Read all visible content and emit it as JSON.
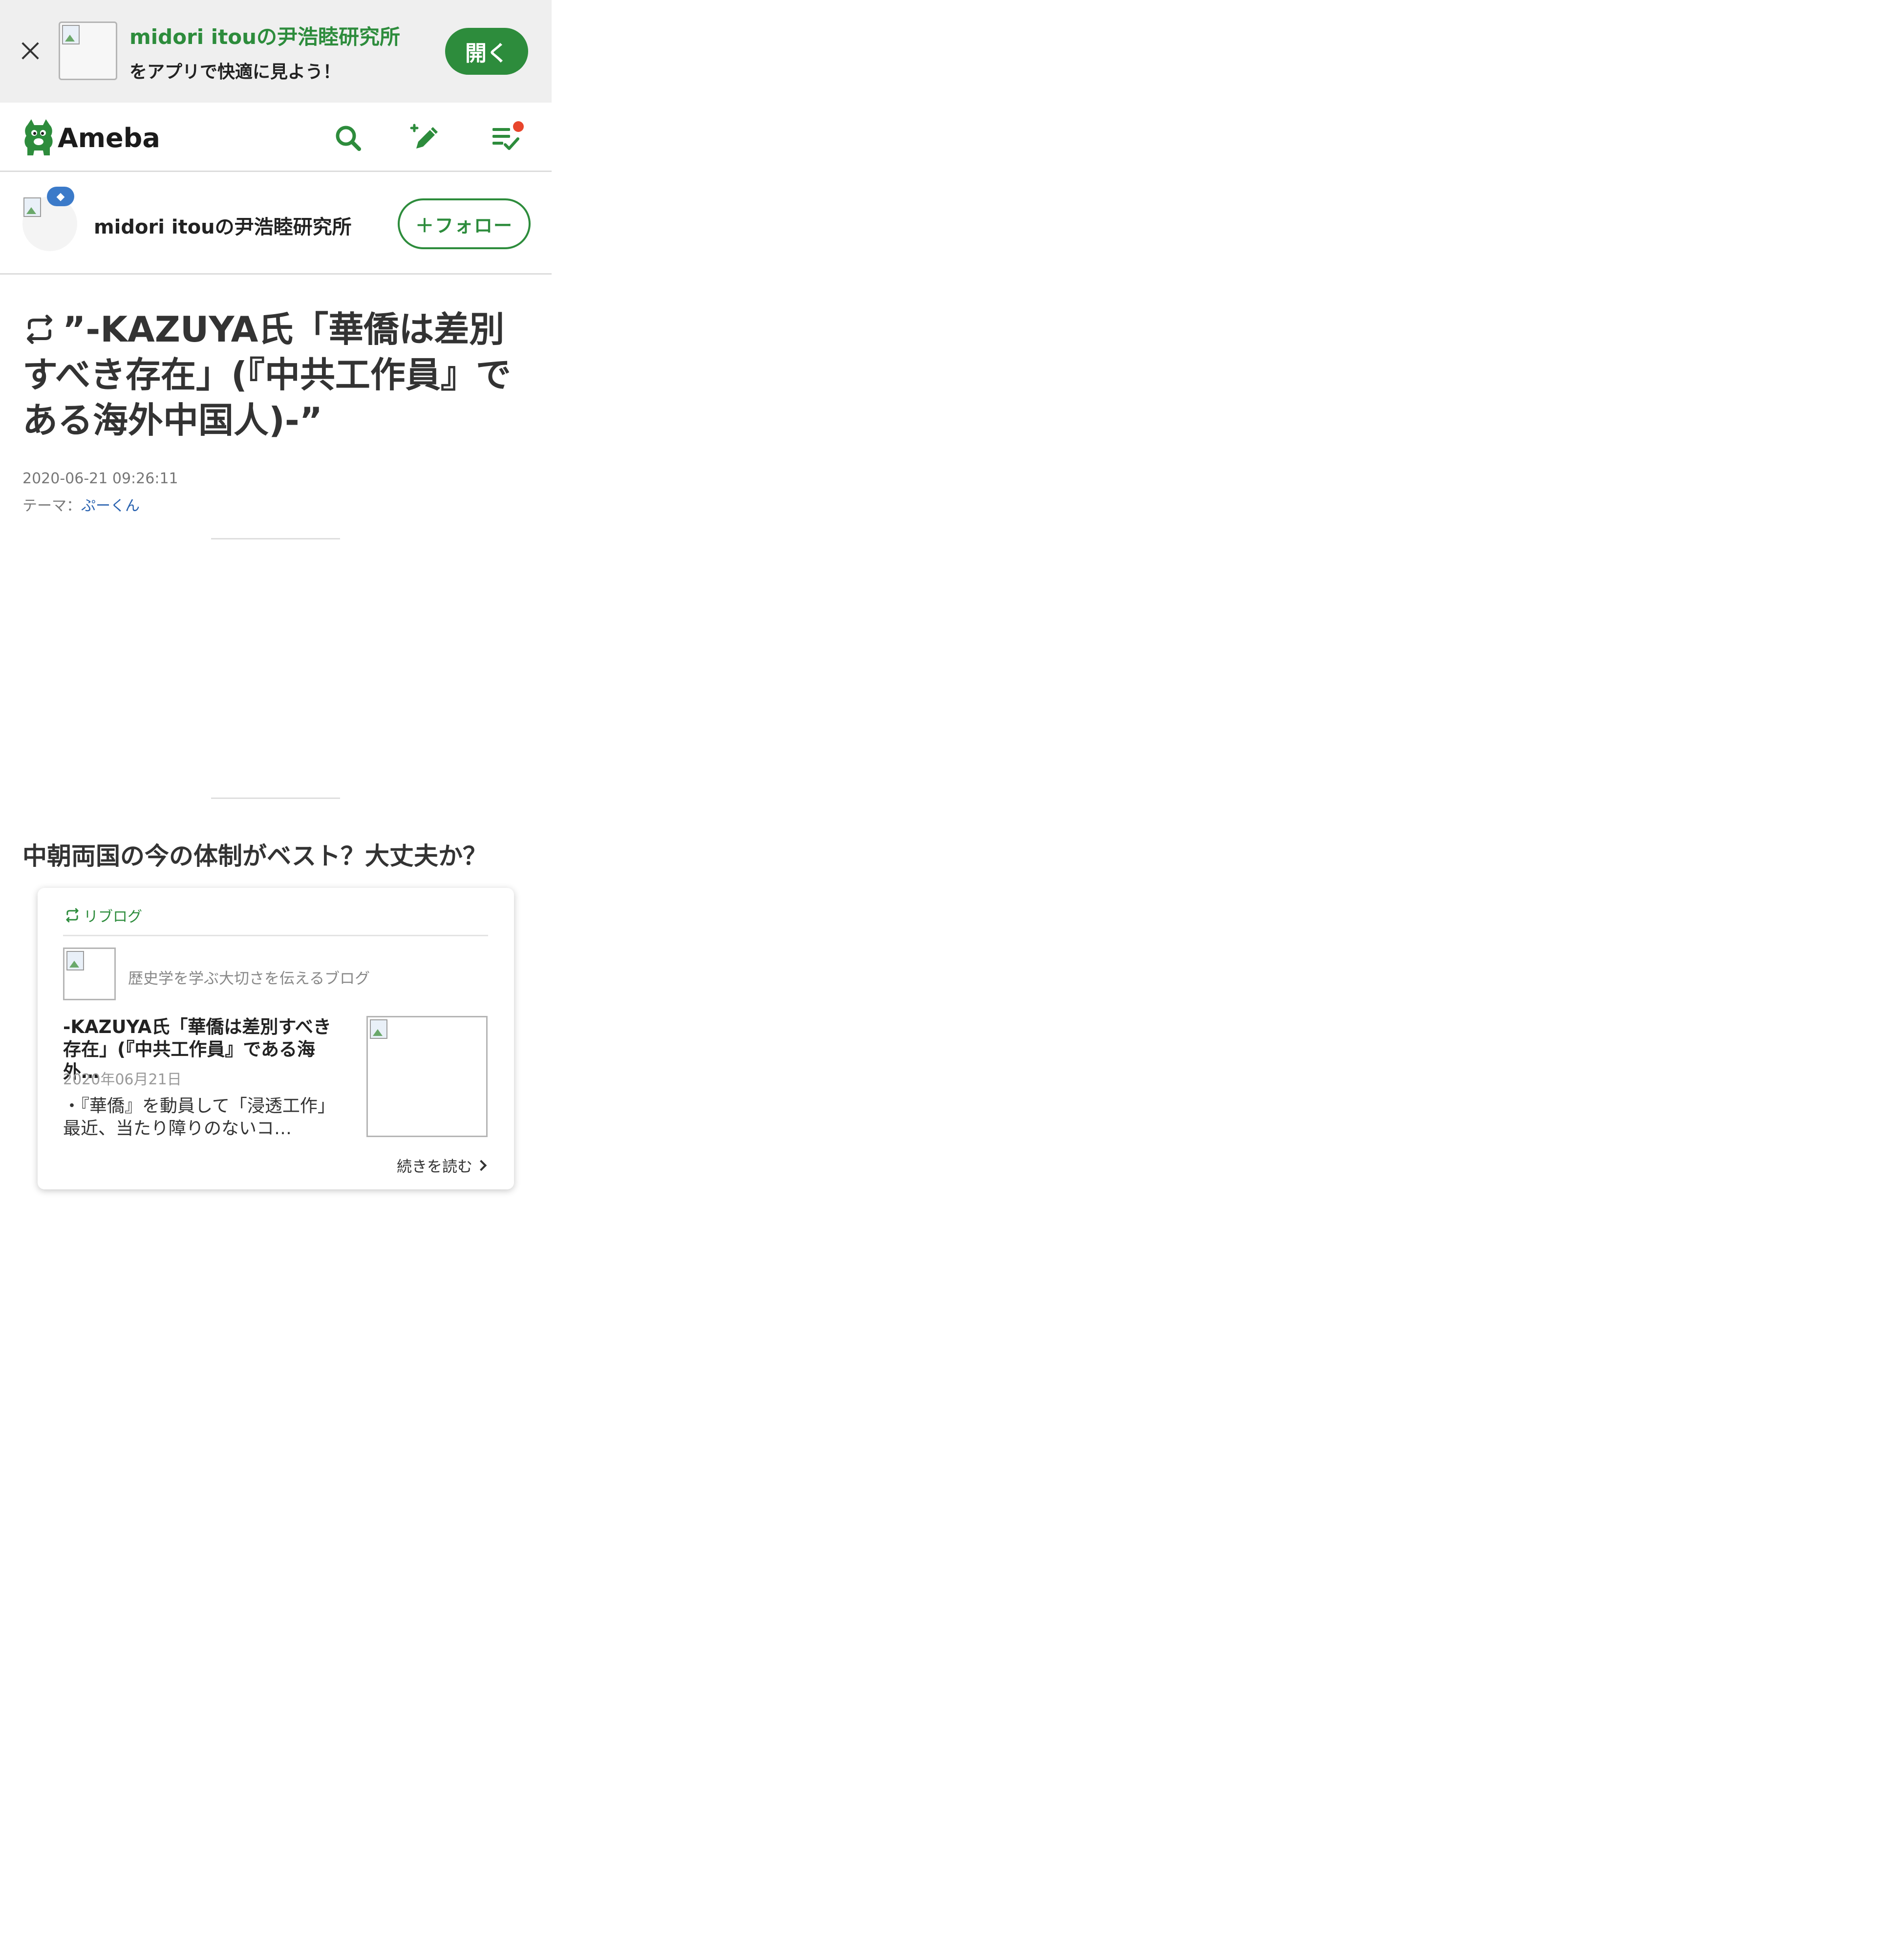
{
  "app_banner": {
    "title": "midori itouの尹浩睦研究所",
    "subtitle": "をアプリで快適に見よう！",
    "open_label": "開く"
  },
  "header": {
    "logo_text": "Ameba",
    "icons": [
      "search-icon",
      "write-blog-icon",
      "reading-list-icon"
    ],
    "notification_dot": true,
    "accent_color": "#2d8c3c"
  },
  "blog": {
    "name": "midori itouの尹浩睦研究所",
    "follow_label": "＋フォロー"
  },
  "article": {
    "title": "”-KAZUYA氏「華僑は差別すべき存在」(『中共工作員』である海外中国人)-”",
    "date": "2020-06-21 09:26:11",
    "theme_prefix": "テーマ：",
    "theme": "ぷーくん",
    "section_heading": "中朝両国の今の体制がベスト？大丈夫か？"
  },
  "reblog_card": {
    "label": "リブログ",
    "source_blog_name": "歴史学を学ぶ大切さを伝えるブログ",
    "entry_title": "-KAZUYA氏「華僑は差別すべき存在」(『中共工作員』である海外…",
    "entry_date": "2020年06月21日",
    "entry_text": "・『華僑』を動員して「浸透工作」最近、当たり障りのないコ…",
    "read_more": "続きを読む"
  }
}
